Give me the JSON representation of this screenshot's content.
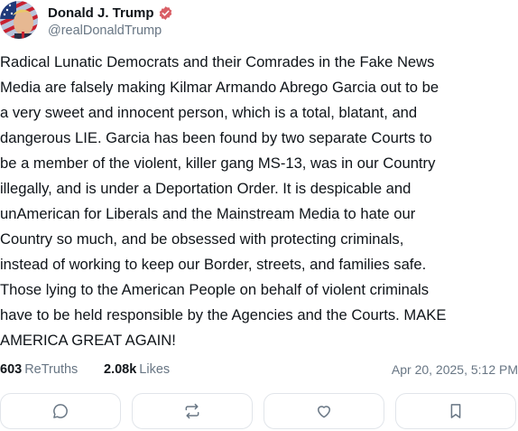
{
  "post": {
    "author": {
      "display_name": "Donald J. Trump",
      "handle": "@realDonaldTrump",
      "verified_icon": "verified-badge-icon"
    },
    "body_lines": [
      "Radical Lunatic Democrats and their Comrades in the Fake News",
      "Media are falsely making Kilmar Armando Abrego Garcia out to be",
      "a very sweet and innocent person, which is a total, blatant, and",
      "dangerous LIE. Garcia has been found by two separate Courts to",
      "be a member of the violent, killer gang MS-13, was in our Country",
      "illegally, and is under a Deportation Order. It is despicable and",
      "unAmerican for Liberals and the Mainstream Media to hate our",
      "Country so much, and be obsessed with protecting criminals,",
      "instead of working to keep our Border, streets, and families safe.",
      "Those lying to the American People on behalf of violent criminals",
      "have to be held responsible by the Agencies and the Courts. MAKE",
      "AMERICA GREAT AGAIN!"
    ],
    "stats": {
      "retruths_count": "603",
      "retruths_label": "ReTruths",
      "likes_count": "2.08k",
      "likes_label": "Likes"
    },
    "timestamp": "Apr 20, 2025, 5:12 PM",
    "actions": [
      {
        "name": "reply",
        "icon": "reply-icon"
      },
      {
        "name": "retruth",
        "icon": "retruth-icon"
      },
      {
        "name": "like",
        "icon": "heart-icon"
      },
      {
        "name": "bookmark",
        "icon": "bookmark-icon"
      }
    ]
  },
  "colors": {
    "text": "#0f1419",
    "muted": "#687684",
    "verified": "#d95e65",
    "border": "#e1e5ea",
    "icon": "#687684"
  }
}
